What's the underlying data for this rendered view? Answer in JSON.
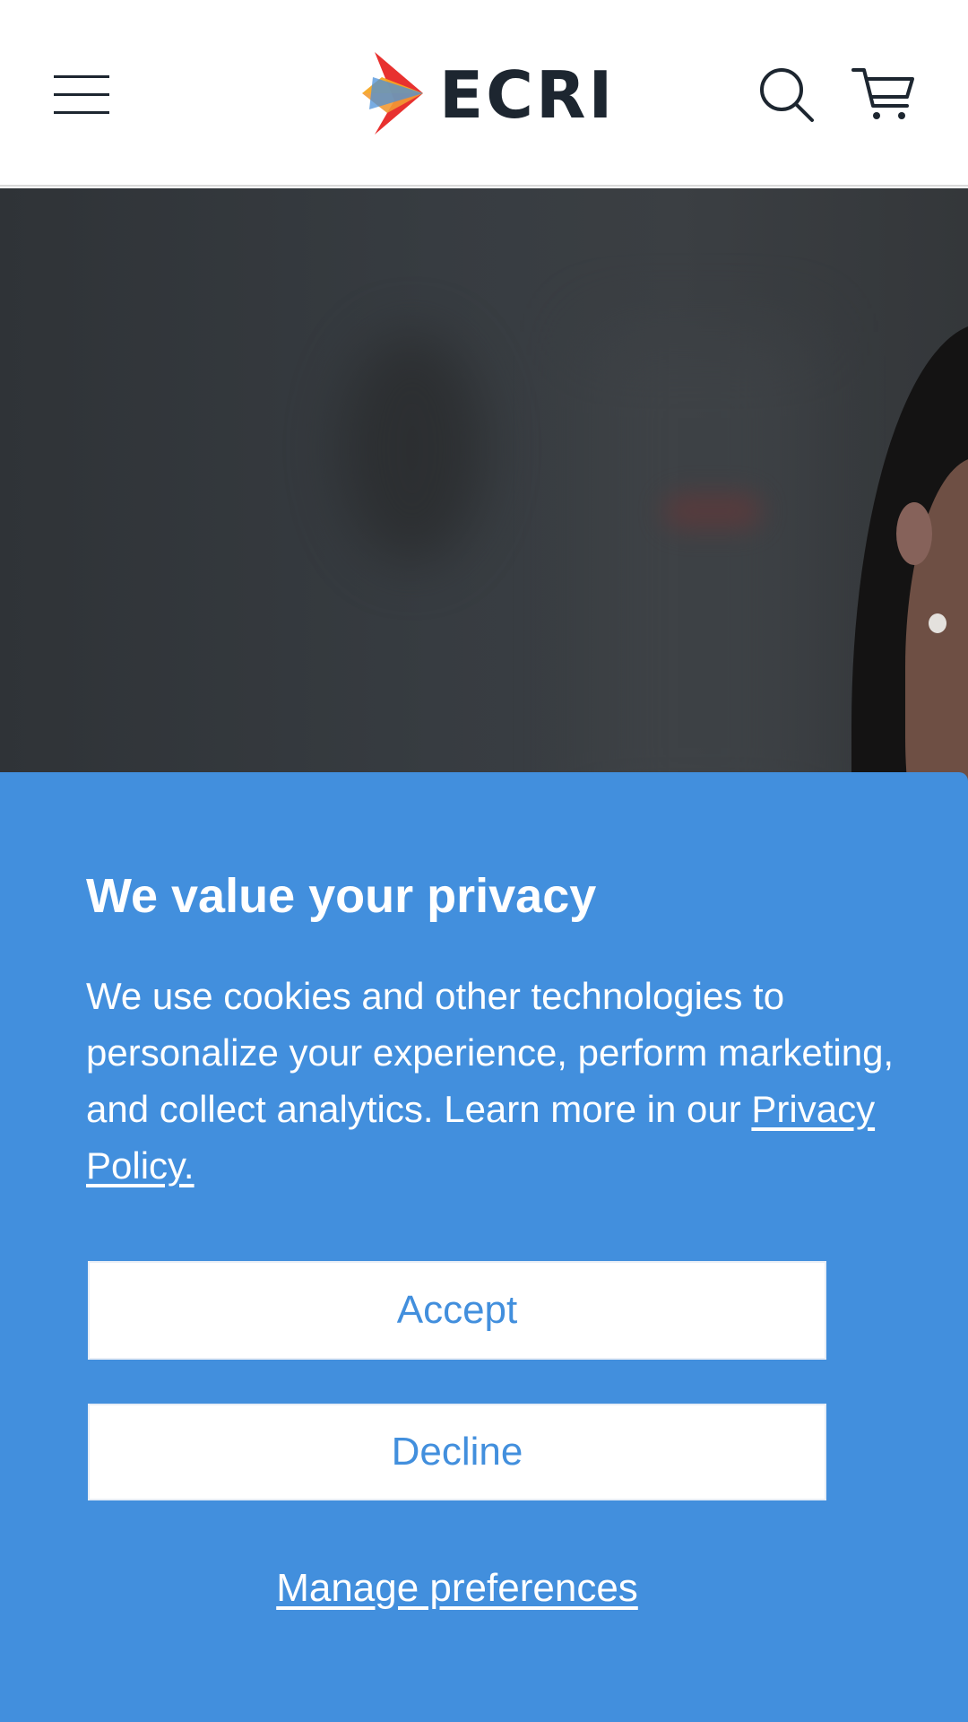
{
  "header": {
    "menu_icon": "hamburger-menu-icon",
    "logo": {
      "text": "ECRI",
      "icon": "ecri-arrow-logo-icon",
      "colors": [
        "#e8312f",
        "#f5a623",
        "#4a90d9"
      ]
    },
    "search_icon": "search-icon",
    "cart_icon": "shopping-cart-icon"
  },
  "consent": {
    "title": "We value your privacy",
    "body_text": "We use cookies and other technologies to personalize your experience, perform marketing, and collect analytics. Learn more in our ",
    "privacy_link_label": "Privacy Policy.",
    "accept_label": "Accept",
    "decline_label": "Decline",
    "manage_label": "Manage preferences"
  },
  "colors": {
    "consent_background": "#428fdd",
    "button_text": "#428fdd",
    "button_background": "#ffffff",
    "header_text": "#1d2630"
  }
}
